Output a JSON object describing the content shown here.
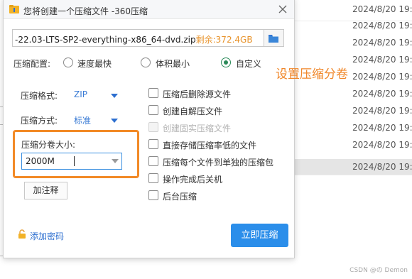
{
  "background": {
    "rows": [
      {
        "date": "2024/8/20 19:4",
        "selected": false
      },
      {
        "date": "2024/8/20 19:4",
        "selected": false
      },
      {
        "date": "2024/8/20 19:4",
        "selected": false
      },
      {
        "date": "2024/8/20 19:4",
        "selected": false
      },
      {
        "date": "2024/8/20 19:4",
        "selected": false
      },
      {
        "date": "2024/8/20 19:4",
        "selected": false
      },
      {
        "date": "2024/8/20 19:4",
        "selected": false
      },
      {
        "date": "2024/8/20 19:4",
        "selected": false
      },
      {
        "date": "2024/8/20 19:4",
        "selected": false
      },
      {
        "date": "2024/8/20 19:2",
        "selected": true
      }
    ],
    "watermark": "CSDN @の Demon"
  },
  "dialog": {
    "title": "您将创建一个压缩文件 -360压缩",
    "path": {
      "value": "-22.03-LTS-SP2-everything-x86_64-dvd.zip",
      "remaining": "剩余:372.4GB"
    },
    "config": {
      "label": "压缩配置:",
      "options": [
        {
          "label": "速度最快",
          "checked": false
        },
        {
          "label": "体积最小",
          "checked": false
        },
        {
          "label": "自定义",
          "checked": true
        }
      ]
    },
    "format": {
      "label": "压缩格式:",
      "value": "ZIP"
    },
    "method": {
      "label": "压缩方式:",
      "value": "标准"
    },
    "volume": {
      "label": "压缩分卷大小:",
      "value": "2000M"
    },
    "note_button": "加注释",
    "checkboxes": [
      {
        "label": "压缩后删除源文件",
        "disabled": false
      },
      {
        "label": "创建自解压文件",
        "disabled": false
      },
      {
        "label": "创建固实压缩文件",
        "disabled": true
      },
      {
        "label": "直接存储压缩率低的文件",
        "disabled": false
      },
      {
        "label": "压缩每个文件到单独的压缩包",
        "disabled": false
      },
      {
        "label": "操作完成后关机",
        "disabled": false
      },
      {
        "label": "后台压缩",
        "disabled": false
      }
    ],
    "add_password": "添加密码",
    "compress_button": "立即压缩"
  },
  "annotation": "设置压缩分卷",
  "colors": {
    "accent_blue": "#2b8eea",
    "highlight_orange": "#f28a27",
    "radio_green": "#2a8a58",
    "remaining_orange": "#e8932b"
  }
}
